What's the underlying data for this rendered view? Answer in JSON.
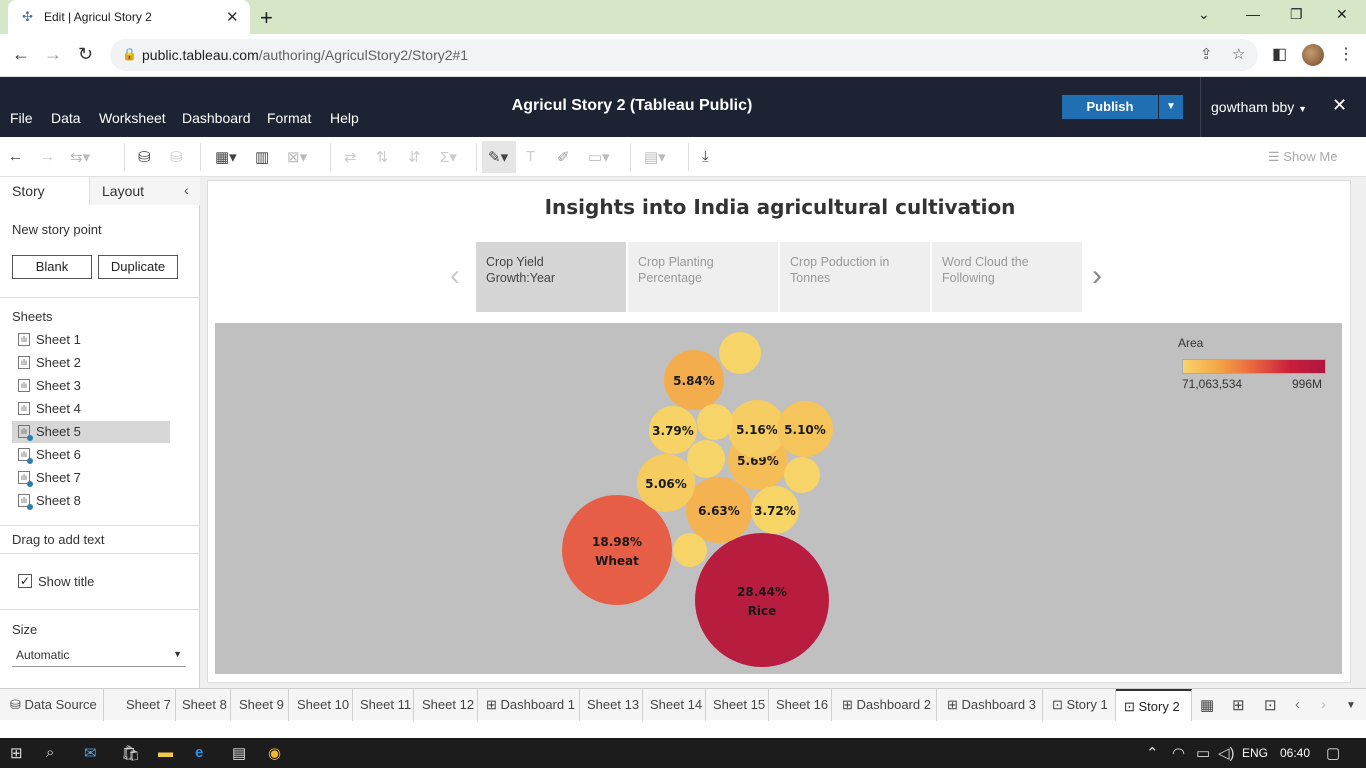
{
  "browser": {
    "tab_title": "Edit | Agricul Story 2",
    "url_host": "public.tableau.com",
    "url_path": "/authoring/AgriculStory2/Story2#1"
  },
  "app": {
    "title": "Agricul Story 2 (Tableau Public)",
    "menu": [
      "File",
      "Data",
      "Worksheet",
      "Dashboard",
      "Format",
      "Help"
    ],
    "publish_label": "Publish",
    "user_name": "gowtham bby",
    "show_me_label": "Show Me"
  },
  "left_panel": {
    "tab_story": "Story",
    "tab_layout": "Layout",
    "new_story_point": "New story point",
    "blank_label": "Blank",
    "duplicate_label": "Duplicate",
    "sheets_heading": "Sheets",
    "sheets": [
      "Sheet 1",
      "Sheet 2",
      "Sheet 3",
      "Sheet 4",
      "Sheet 5",
      "Sheet 6",
      "Sheet 7",
      "Sheet 8"
    ],
    "selected_sheet": "Sheet 5",
    "drag_text": "Drag to add text",
    "show_title_label": "Show title",
    "show_title_checked": true,
    "size_heading": "Size",
    "size_value": "Automatic"
  },
  "story": {
    "title": "Insights into India agricultural cultivation",
    "points": [
      "Crop Yield Growth:Year",
      "Crop Planting Percentage",
      "Crop Poduction in Tonnes",
      "Word Cloud the Following"
    ],
    "active_point": 0
  },
  "legend": {
    "title": "Area",
    "min_label": "71,063,534",
    "max_label": "996M",
    "colors": [
      "#f7d46b",
      "#f4a546",
      "#e9643f",
      "#c91f3d",
      "#b0153e"
    ]
  },
  "chart_data": {
    "type": "packed-bubble",
    "measure": "Area",
    "bubbles": [
      {
        "label": "28.44%",
        "crop": "Rice",
        "share": 28.44,
        "color": "#b81c3f"
      },
      {
        "label": "18.98%",
        "crop": "Wheat",
        "share": 18.98,
        "color": "#e55e45"
      },
      {
        "label": "6.63%",
        "crop": "",
        "share": 6.63,
        "color": "#f4b350"
      },
      {
        "label": "5.84%",
        "crop": "",
        "share": 5.84,
        "color": "#f4ad4c"
      },
      {
        "label": "5.69%",
        "crop": "",
        "share": 5.69,
        "color": "#f5bd56"
      },
      {
        "label": "5.16%",
        "crop": "",
        "share": 5.16,
        "color": "#f6cd62"
      },
      {
        "label": "5.10%",
        "crop": "",
        "share": 5.1,
        "color": "#f5c45a"
      },
      {
        "label": "5.06%",
        "crop": "",
        "share": 5.06,
        "color": "#f6cc60"
      },
      {
        "label": "3.79%",
        "crop": "",
        "share": 3.79,
        "color": "#f6d364"
      },
      {
        "label": "3.72%",
        "crop": "",
        "share": 3.72,
        "color": "#f6d466"
      },
      {
        "label": "",
        "crop": "",
        "share": null,
        "color": "#f6d468"
      },
      {
        "label": "",
        "crop": "",
        "share": null,
        "color": "#f6d468"
      },
      {
        "label": "",
        "crop": "",
        "share": null,
        "color": "#f6d468"
      },
      {
        "label": "",
        "crop": "",
        "share": null,
        "color": "#f6d468"
      },
      {
        "label": "",
        "crop": "",
        "share": null,
        "color": "#f6d468"
      }
    ]
  },
  "sheet_tabs": [
    "Data Source",
    "Sheet 7",
    "Sheet 8",
    "Sheet 9",
    "Sheet 10",
    "Sheet 11",
    "Sheet 12",
    "Dashboard 1",
    "Sheet 13",
    "Sheet 14",
    "Sheet 15",
    "Sheet 16",
    "Dashboard 2",
    "Dashboard 3",
    "Story 1",
    "Story 2"
  ],
  "active_sheet_tab": "Story 2",
  "taskbar": {
    "lang": "ENG",
    "time": "06:40"
  }
}
